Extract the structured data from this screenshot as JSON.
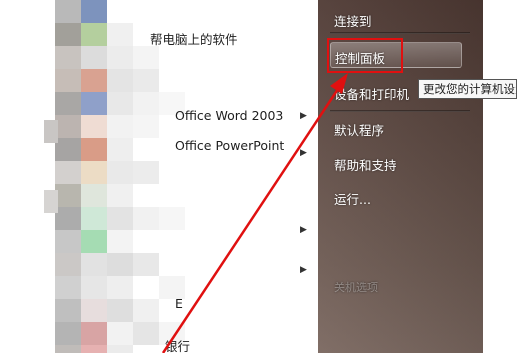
{
  "start_menu": {
    "left": {
      "items": [
        {
          "label": "帮电脑上的软件",
          "has_submenu": false
        },
        {
          "label": "Office Word 2003",
          "has_submenu": true
        },
        {
          "label": "Office PowerPoint",
          "has_submenu": true
        },
        {
          "label": "",
          "has_submenu": true
        },
        {
          "label": "",
          "has_submenu": true
        },
        {
          "label": "E",
          "has_submenu": false
        },
        {
          "label": "银行",
          "has_submenu": false
        }
      ]
    },
    "right": {
      "items": [
        {
          "label": "连接到"
        },
        {
          "label": "控制面板",
          "selected": true
        },
        {
          "label": "设备和打印机"
        },
        {
          "label": "默认程序"
        },
        {
          "label": "帮助和支持"
        },
        {
          "label": "运行..."
        },
        {
          "label": "关机选项"
        }
      ],
      "tooltip": "更改您的计算机设置"
    },
    "colors": {
      "panel_top": "#4f3a34",
      "panel_bottom": "#7a675f",
      "annotation_red": "#e01010"
    }
  }
}
